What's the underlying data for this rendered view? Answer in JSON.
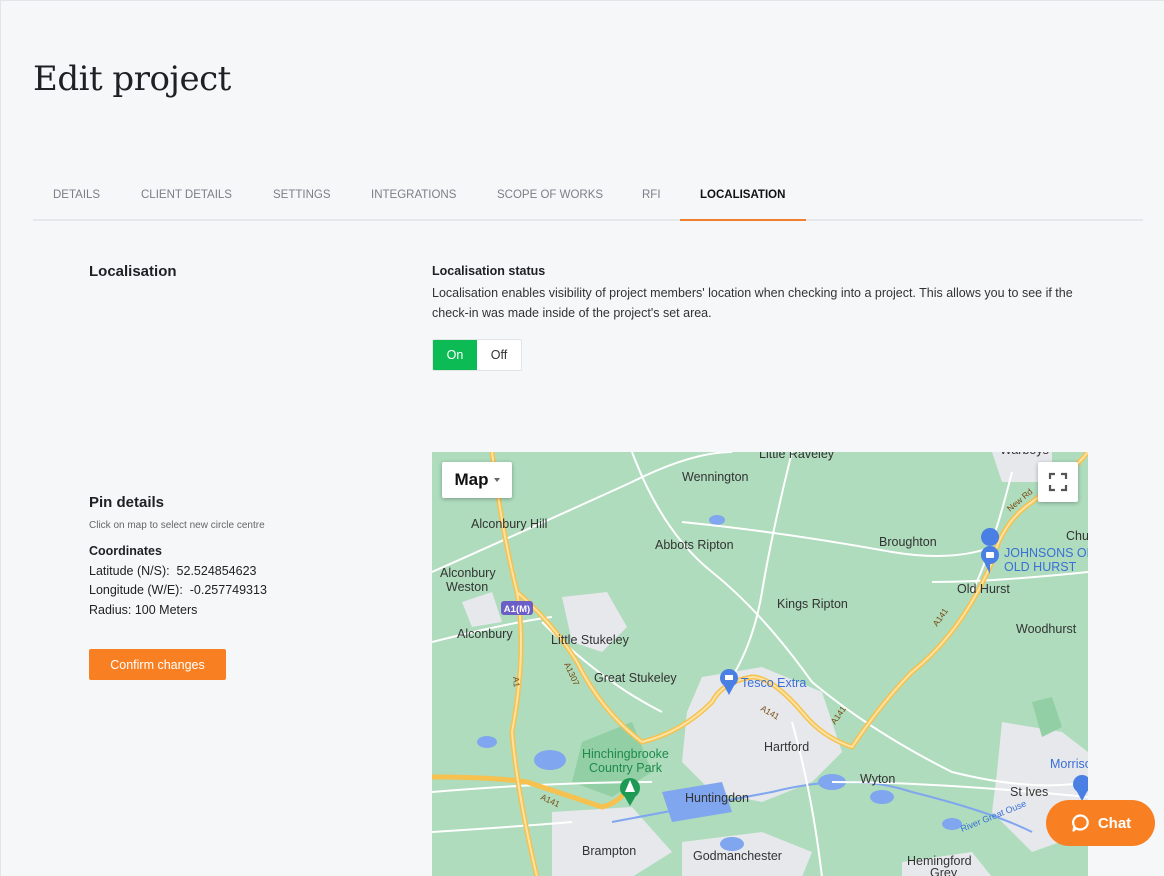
{
  "page": {
    "title": "Edit project"
  },
  "tabs": [
    {
      "label": "DETAILS",
      "active": false
    },
    {
      "label": "CLIENT DETAILS",
      "active": false
    },
    {
      "label": "SETTINGS",
      "active": false
    },
    {
      "label": "INTEGRATIONS",
      "active": false
    },
    {
      "label": "SCOPE OF WORKS",
      "active": false
    },
    {
      "label": "RFI",
      "active": false
    },
    {
      "label": "LOCALISATION",
      "active": true
    }
  ],
  "localisation": {
    "section_title": "Localisation",
    "status_title": "Localisation status",
    "status_description": "Localisation enables visibility of project members' location when checking into a project. This allows you to see if the check-in was made inside of the project's set area.",
    "toggle": {
      "on_label": "On",
      "off_label": "Off",
      "selected": "On"
    }
  },
  "pin_details": {
    "title": "Pin details",
    "hint": "Click on map to select new circle centre",
    "coordinates_title": "Coordinates",
    "latitude_label": "Latitude (N/S):",
    "latitude_value": "52.524854623",
    "longitude_label": "Longitude (W/E):",
    "longitude_value": "-0.257749313",
    "radius_text": "Radius: 100 Meters",
    "confirm_label": "Confirm changes"
  },
  "map": {
    "type_label": "Map",
    "place_labels": [
      "Little Raveley",
      "Warboys",
      "Wennington",
      "Alconbury Hill",
      "Abbots Ripton",
      "Broughton",
      "Chu",
      "Alconbury",
      "Weston",
      "Old Hurst",
      "Kings Ripton",
      "Alconbury",
      "Little Stukeley",
      "Woodhurst",
      "Great Stukeley",
      "Hartford",
      "Hinchingbrooke",
      "Country Park",
      "Wyton",
      "St Ives",
      "Huntingdon",
      "Brampton",
      "Godmanchester",
      "Hemingford",
      "Grey",
      "River Great Ouse"
    ],
    "poi_labels": [
      "JOHNSONS OF",
      "OLD HURST",
      "Tesco Extra",
      "Morrisons"
    ],
    "road_labels": [
      "A1(M)",
      "A1307",
      "A1",
      "A141",
      "A141",
      "A141",
      "A141",
      "New Rd"
    ]
  },
  "chat": {
    "label": "Chat"
  },
  "colors": {
    "accent": "#f98022",
    "toggle_on": "#0dbb55",
    "tab_underline": "#f08030"
  }
}
